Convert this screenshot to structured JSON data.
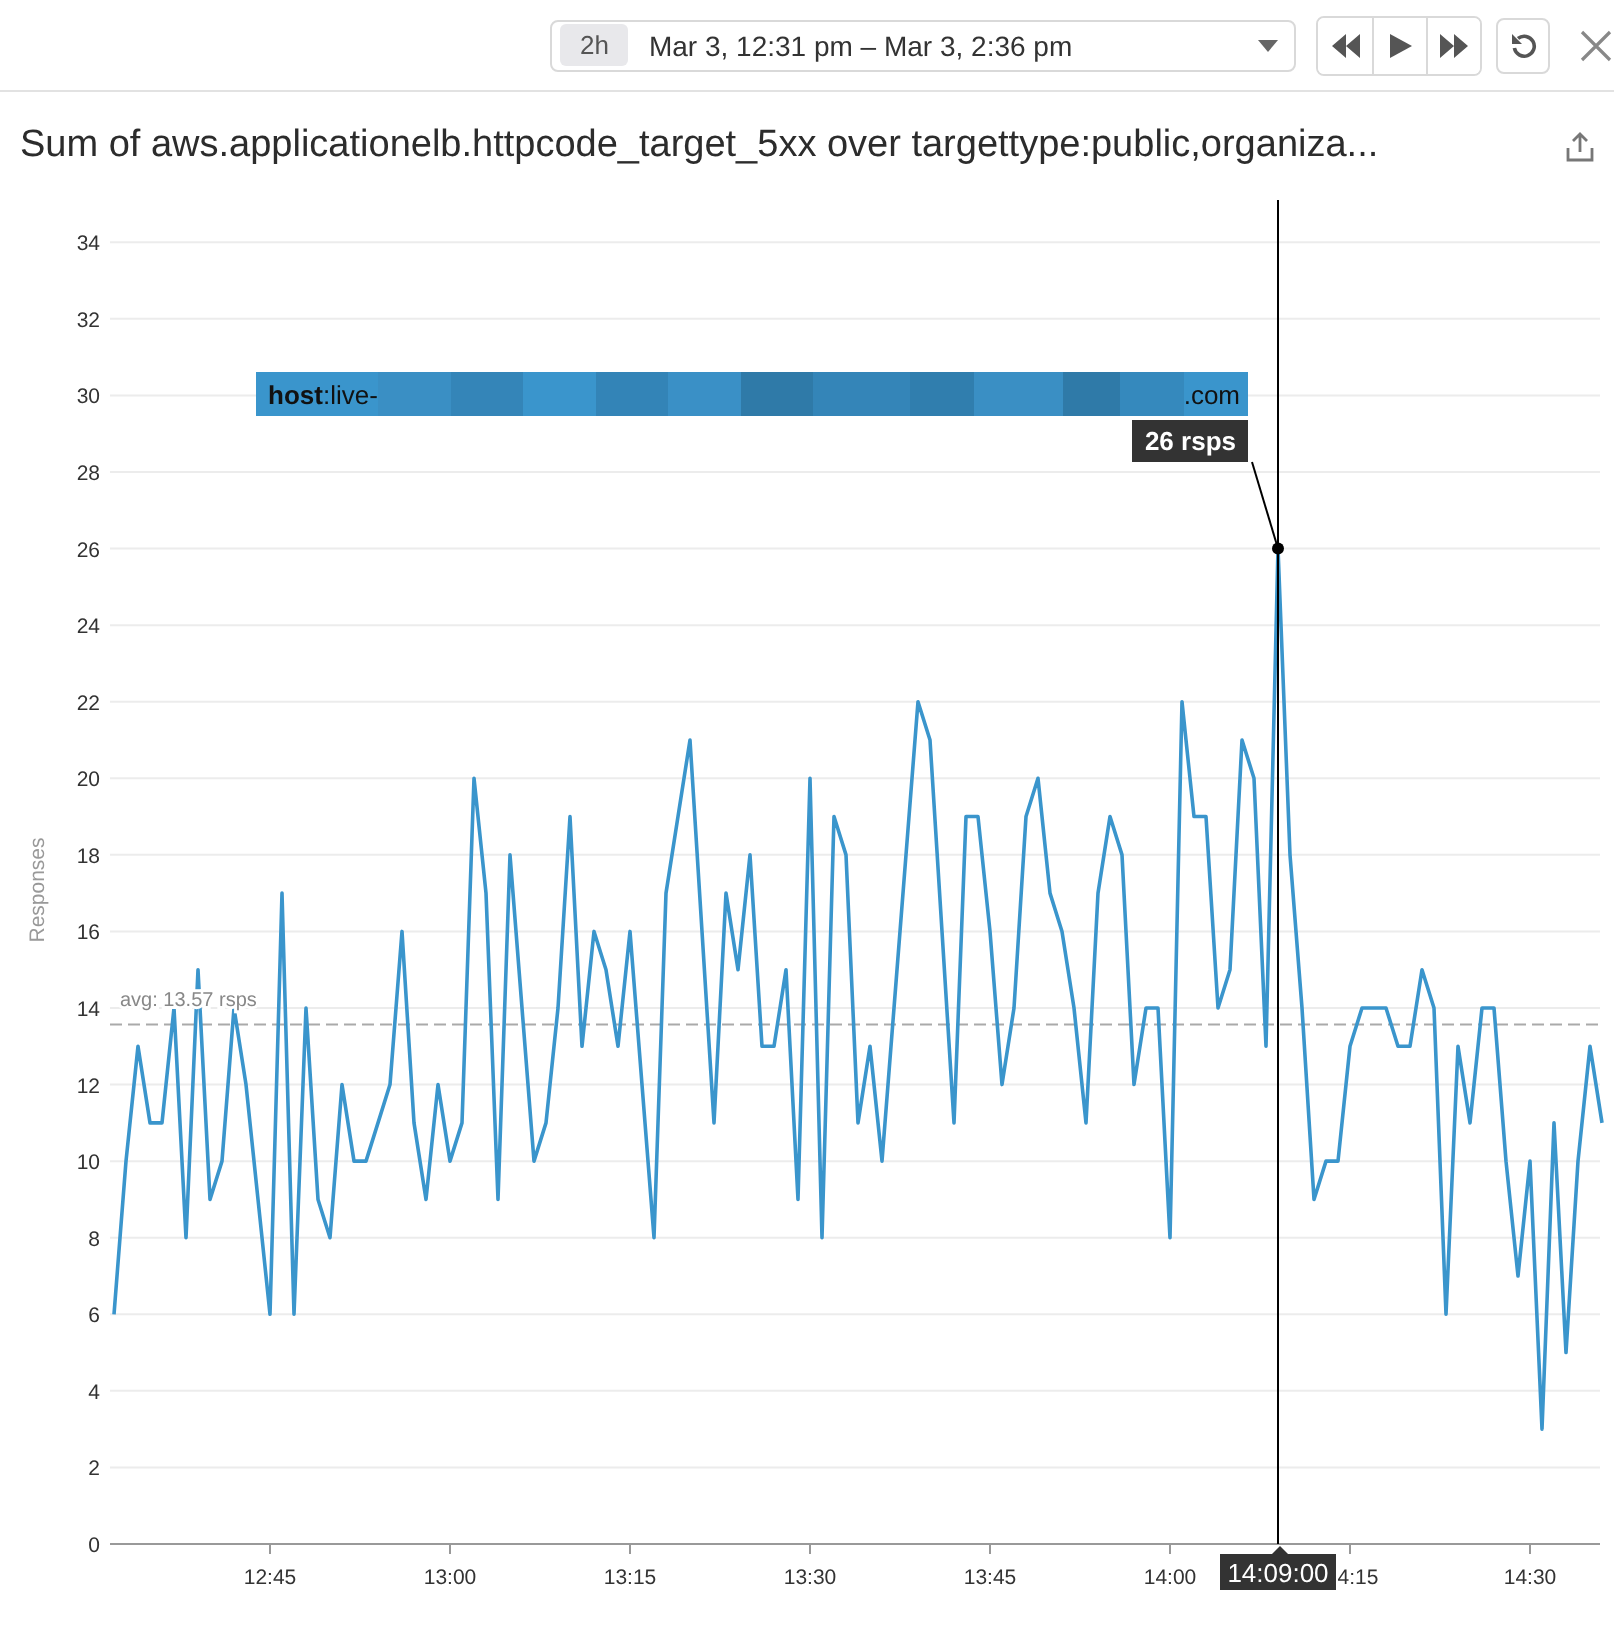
{
  "toolbar": {
    "duration": "2h",
    "time_range": "Mar 3, 12:31 pm – Mar 3, 2:36 pm"
  },
  "widget": {
    "title": "Sum of aws.applicationelb.httpcode_target_5xx over targettype:public,organiza...",
    "chart_data": {
      "type": "line",
      "ylabel": "Responses",
      "categories": [
        null,
        null,
        null,
        null,
        null,
        null,
        null,
        null,
        null,
        null,
        null,
        null,
        null,
        "12:45",
        null,
        null,
        null,
        null,
        null,
        null,
        null,
        null,
        null,
        null,
        null,
        null,
        null,
        null,
        "13:00",
        null,
        null,
        null,
        null,
        null,
        null,
        null,
        null,
        null,
        null,
        null,
        null,
        null,
        null,
        "13:15",
        null,
        null,
        null,
        null,
        null,
        null,
        null,
        null,
        null,
        null,
        null,
        null,
        null,
        null,
        "13:30",
        null,
        null,
        null,
        null,
        null,
        null,
        null,
        null,
        null,
        null,
        null,
        null,
        null,
        null,
        "13:45",
        null,
        null,
        null,
        null,
        null,
        null,
        null,
        null,
        null,
        null,
        null,
        null,
        null,
        null,
        "14:00",
        null,
        null,
        null,
        null,
        null,
        null,
        null,
        null,
        null,
        null,
        null,
        null,
        null,
        null,
        "4:15",
        null,
        null,
        null,
        null,
        null,
        null,
        null,
        null,
        null,
        null,
        null,
        null,
        null,
        null,
        "14:30",
        null,
        null,
        null,
        null,
        null,
        null
      ],
      "series": [
        {
          "color": "#3a95cc",
          "values": [
            6,
            10,
            13,
            11,
            11,
            14,
            8,
            15,
            9,
            10,
            14,
            12,
            9,
            6,
            17,
            6,
            14,
            9,
            8,
            12,
            10,
            10,
            11,
            12,
            16,
            11,
            9,
            12,
            10,
            11,
            20,
            17,
            9,
            18,
            14,
            10,
            11,
            14,
            19,
            13,
            16,
            15,
            13,
            16,
            12,
            8,
            17,
            19,
            21,
            16,
            11,
            17,
            15,
            18,
            13,
            13,
            15,
            9,
            20,
            8,
            19,
            18,
            11,
            13,
            10,
            14,
            18,
            22,
            21,
            16,
            11,
            19,
            19,
            16,
            12,
            14,
            19,
            20,
            17,
            16,
            14,
            11,
            17,
            19,
            18,
            12,
            14,
            14,
            8,
            22,
            19,
            19,
            14,
            15,
            21,
            20,
            13,
            26,
            18,
            14,
            9,
            10,
            10,
            13,
            14,
            14,
            14,
            13,
            13,
            15,
            14,
            6,
            13,
            11,
            14,
            14,
            10,
            7,
            10,
            3,
            11,
            5,
            10,
            13,
            11
          ]
        }
      ],
      "ylim": [
        0,
        35
      ],
      "yticks": [
        0,
        2,
        4,
        6,
        8,
        10,
        12,
        14,
        16,
        18,
        20,
        22,
        24,
        26,
        28,
        30,
        32,
        34
      ],
      "grid": true,
      "ref_lines": [
        {
          "axis": "y",
          "value": 13.57,
          "label": "avg: 13.57 rsps"
        }
      ]
    }
  },
  "tooltip": {
    "label": "**host**:live-",
    "suffix": ".com",
    "value": "26 rsps",
    "time": "14:09:00"
  }
}
